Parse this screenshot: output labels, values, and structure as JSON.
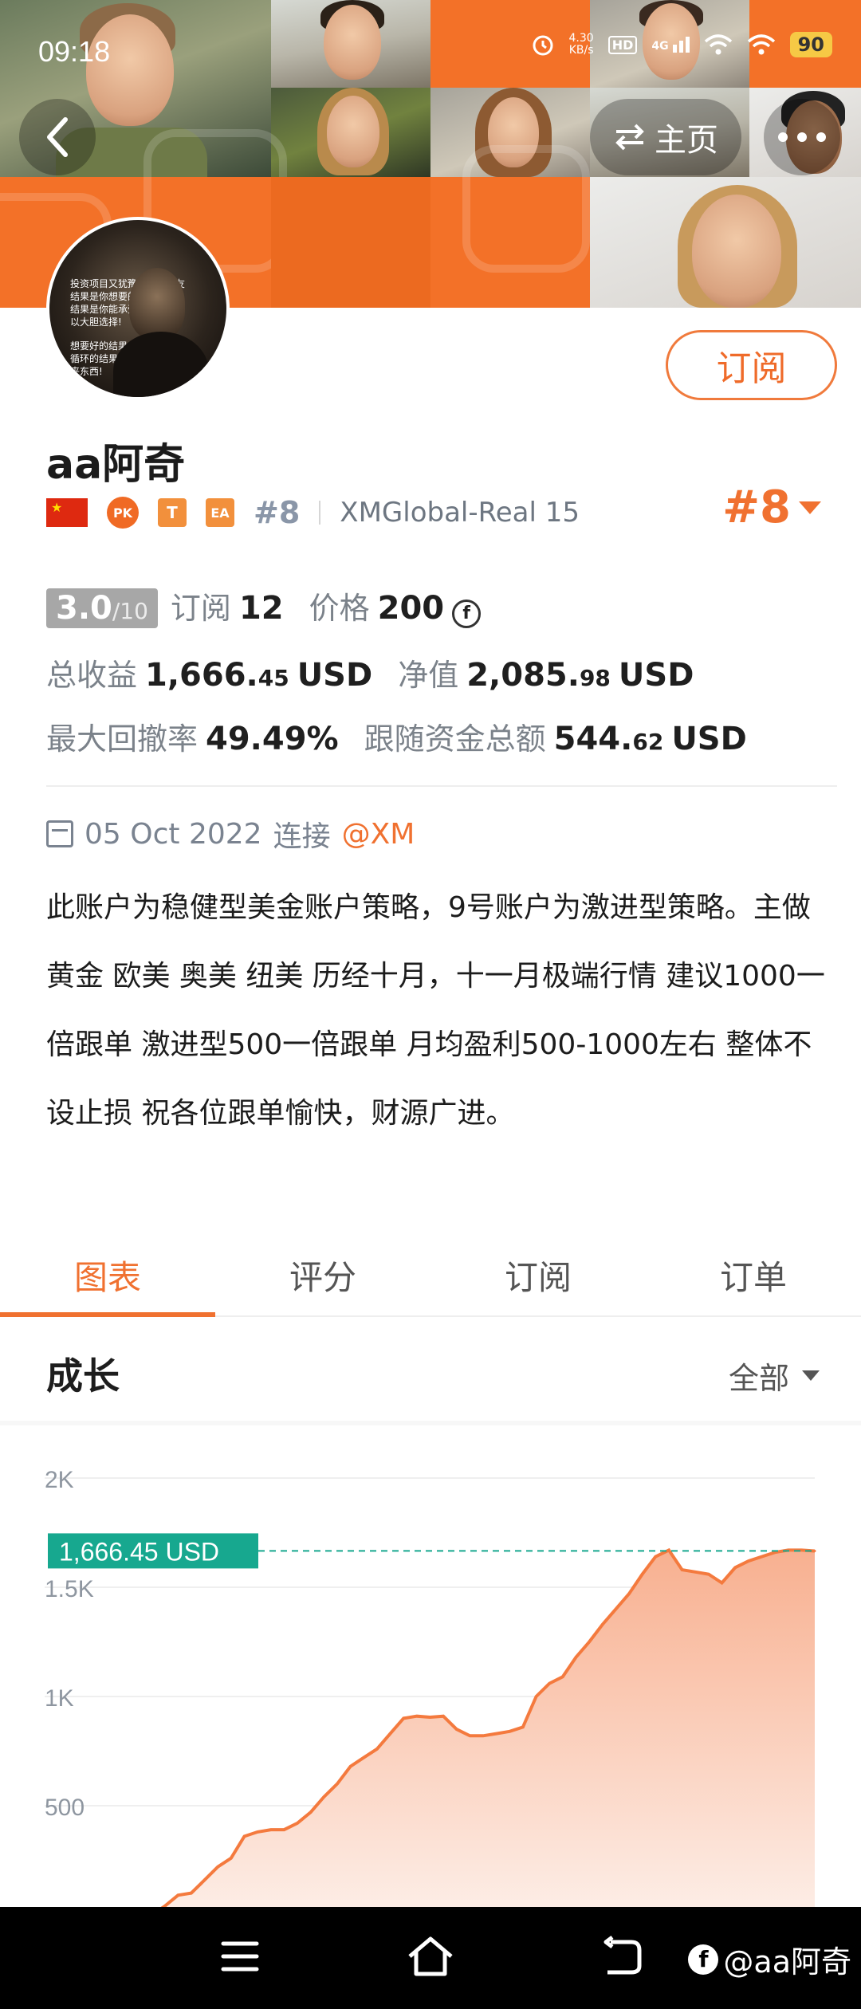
{
  "status_bar": {
    "time": "09:18",
    "net_speed_value": "4.30",
    "net_speed_unit": "KB/s",
    "hd": "HD",
    "signal": "4G",
    "battery": "90"
  },
  "header": {
    "back_icon": "chevron-left-icon",
    "home_label": "主页",
    "more_icon": "more-horizontal-icon"
  },
  "profile": {
    "name": "aa阿奇",
    "subscribe_label": "订阅",
    "rank_badge": "#8",
    "rank_right": "#8",
    "server": "XMGlobal-Real 15",
    "badges": {
      "pk": "PK",
      "t": "T",
      "ea": "EA"
    },
    "avatar_lines": [
      "投资项目又犹豫不决的朋友",
      "结果是你想要的",
      "结果是你能承受的",
      "以大胆选择!",
      "想要好的结果",
      "循环的结果",
      "来东西!"
    ]
  },
  "stats": {
    "score": "3.0",
    "score_of": "/10",
    "subscribe_label": "订阅",
    "subscribe_count": "12",
    "price_label": "价格",
    "price_value": "200",
    "coin_symbol": "f",
    "total_profit_label": "总收益",
    "total_profit_main": "1,666.",
    "total_profit_dec": "45",
    "total_profit_unit": "USD",
    "equity_label": "净值",
    "equity_main": "2,085.",
    "equity_dec": "98",
    "equity_unit": "USD",
    "drawdown_label": "最大回撤率",
    "drawdown_value": "49.49%",
    "follow_label": "跟随资金总额",
    "follow_main": "544.",
    "follow_dec": "62",
    "follow_unit": "USD"
  },
  "connection": {
    "date": "05 Oct 2022",
    "connect_label": "连接",
    "broker": "@XM"
  },
  "description": "此账户为稳健型美金账户策略，9号账户为激进型策略。主做黄金 欧美 奥美 纽美 历经十月，十一月极端行情 建议1000一倍跟单 激进型500一倍跟单 月均盈利500-1000左右 整体不设止损 祝各位跟单愉快，财源广进。",
  "tabs": [
    {
      "label": "图表",
      "active": true
    },
    {
      "label": "评分",
      "active": false
    },
    {
      "label": "订阅",
      "active": false
    },
    {
      "label": "订单",
      "active": false
    }
  ],
  "growth": {
    "title": "成长",
    "range_label": "全部"
  },
  "chart_data": {
    "type": "area",
    "title": "",
    "xlabel": "",
    "ylabel": "",
    "ylim": [
      0,
      2000
    ],
    "yticks": [
      "2K",
      "1.5K",
      "1K",
      "500"
    ],
    "current_label": "1,666.45 USD",
    "current_value": 1666.45,
    "x": [
      0,
      1,
      2,
      3,
      4,
      5,
      6,
      7,
      8,
      9,
      10,
      11,
      12,
      13,
      14,
      15,
      16,
      17,
      18,
      19,
      20,
      21,
      22,
      23,
      24,
      25,
      26,
      27,
      28,
      29,
      30,
      31,
      32,
      33,
      34,
      35,
      36,
      37,
      38,
      39,
      40,
      41,
      42,
      43,
      44,
      45,
      46,
      47,
      48,
      49,
      50
    ],
    "values": [
      0,
      40,
      90,
      100,
      160,
      220,
      260,
      360,
      380,
      390,
      390,
      420,
      470,
      540,
      600,
      680,
      720,
      760,
      830,
      900,
      910,
      905,
      910,
      850,
      820,
      820,
      830,
      840,
      860,
      1000,
      1060,
      1090,
      1180,
      1250,
      1330,
      1400,
      1470,
      1560,
      1640,
      1670,
      1580,
      1570,
      1560,
      1520,
      1590,
      1620,
      1640,
      1660,
      1670,
      1670,
      1666
    ],
    "grid": true,
    "colors": {
      "line": "#f47a3e",
      "fill_top": "#f8b090",
      "fill_bottom": "#fdeee7",
      "tag": "#17a88f",
      "dashed": "#17a88f"
    }
  },
  "navbar": {
    "menu_icon": "menu-icon",
    "home_icon": "home-icon",
    "back_icon": "back-icon",
    "watermark": "@aa阿奇"
  }
}
